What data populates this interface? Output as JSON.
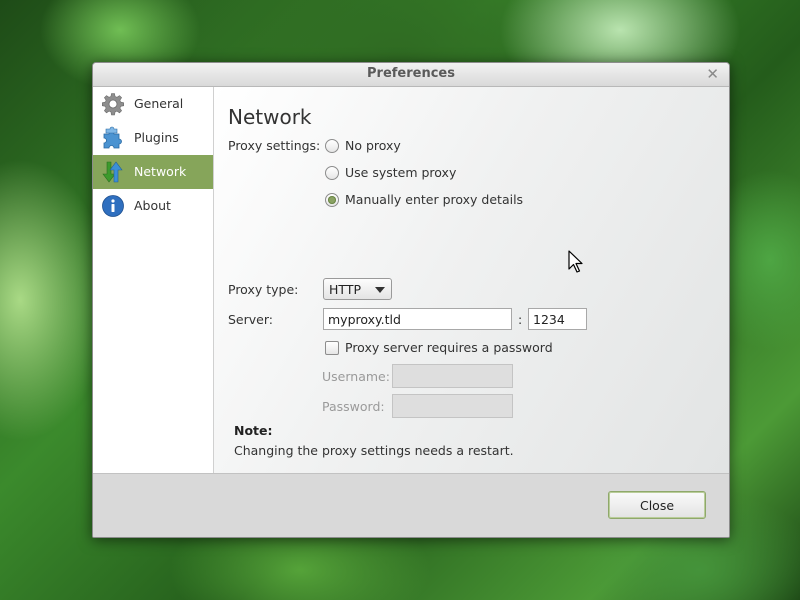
{
  "window": {
    "title": "Preferences"
  },
  "sidebar": {
    "items": [
      {
        "label": "General",
        "icon": "gear-icon"
      },
      {
        "label": "Plugins",
        "icon": "puzzle-icon"
      },
      {
        "label": "Network",
        "icon": "network-arrows-icon",
        "selected": true
      },
      {
        "label": "About",
        "icon": "info-icon"
      }
    ]
  },
  "network": {
    "heading": "Network",
    "proxy_settings_label": "Proxy settings:",
    "options": [
      "No proxy",
      "Use system proxy",
      "Manually enter proxy details"
    ],
    "selected_option": "Manually enter proxy details",
    "proxy_type_label": "Proxy type:",
    "proxy_type_value": "HTTP",
    "server_label": "Server:",
    "server_value": "myproxy.tld",
    "port_separator": ":",
    "port_value": "1234",
    "auth_checkbox_label": "Proxy server requires a password",
    "auth_checked": false,
    "username_label": "Username:",
    "password_label": "Password:"
  },
  "note": {
    "title": "Note:",
    "text": "Changing the proxy settings needs a restart."
  },
  "footer": {
    "close_label": "Close"
  },
  "colors": {
    "accent": "#86a55a",
    "selected_text": "#ffffff"
  }
}
